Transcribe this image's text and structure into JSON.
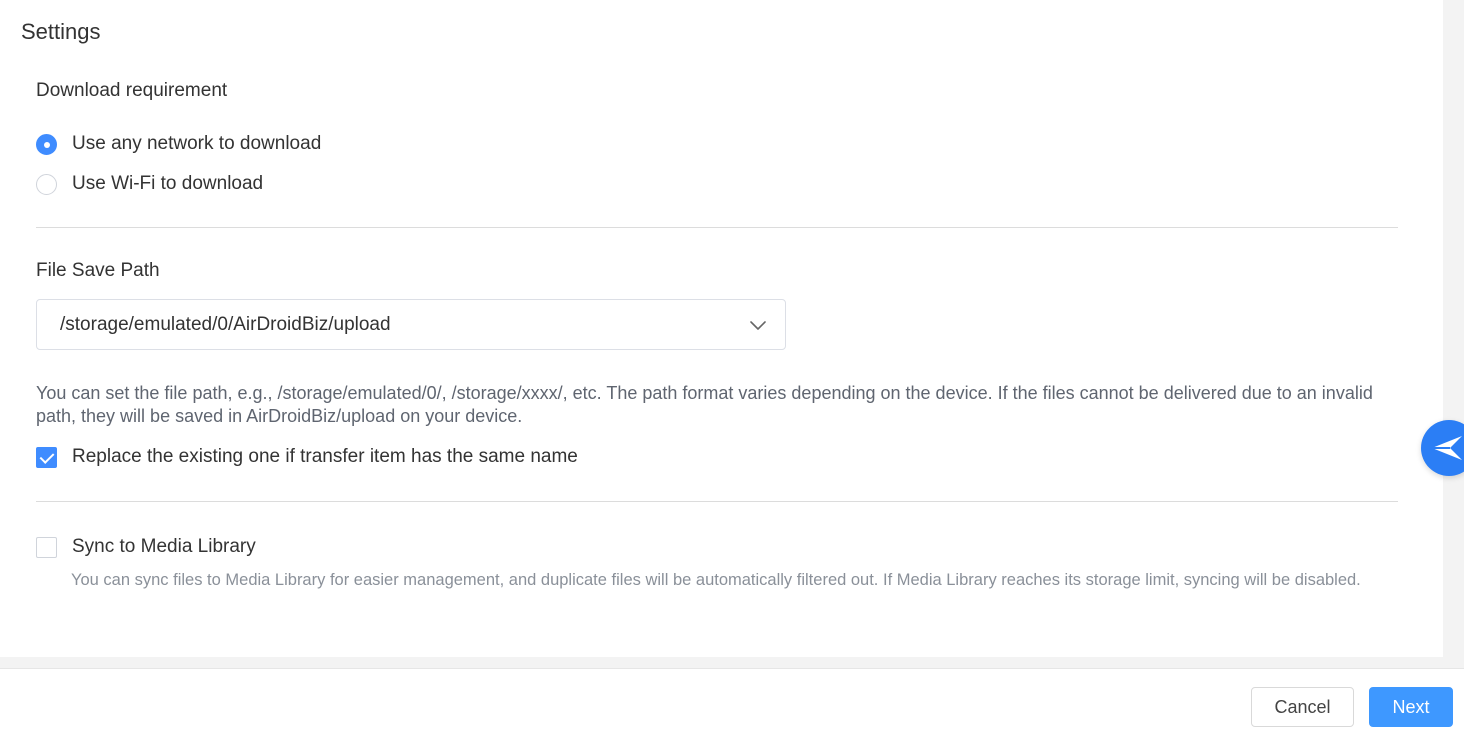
{
  "page": {
    "title": "Settings"
  },
  "download_requirement": {
    "title": "Download requirement",
    "options": [
      {
        "label": "Use any network to download",
        "selected": true
      },
      {
        "label": "Use Wi-Fi to download",
        "selected": false
      }
    ]
  },
  "file_save_path": {
    "title": "File Save Path",
    "selected_path": "/storage/emulated/0/AirDroidBiz/upload",
    "help_text": "You can set the file path, e.g., /storage/emulated/0/, /storage/xxxx/, etc. The path format varies depending on the device. If the files cannot be delivered due to an invalid path, they will be saved in AirDroidBiz/upload on your device.",
    "replace_label": "Replace the existing one if transfer item has the same name",
    "replace_checked": true
  },
  "media_library": {
    "label": "Sync to Media Library",
    "checked": false,
    "help_text": "You can sync files to Media Library for easier management, and duplicate files will be automatically filtered out. If Media Library reaches its storage limit, syncing will be disabled."
  },
  "footer": {
    "cancel_label": "Cancel",
    "next_label": "Next"
  },
  "colors": {
    "accent": "#3f8cff",
    "primary_button": "#3e98ff",
    "fab": "#2b7ef5"
  },
  "icons": {
    "select_chevron": "chevron-down-icon",
    "fab": "send-plane-icon"
  }
}
